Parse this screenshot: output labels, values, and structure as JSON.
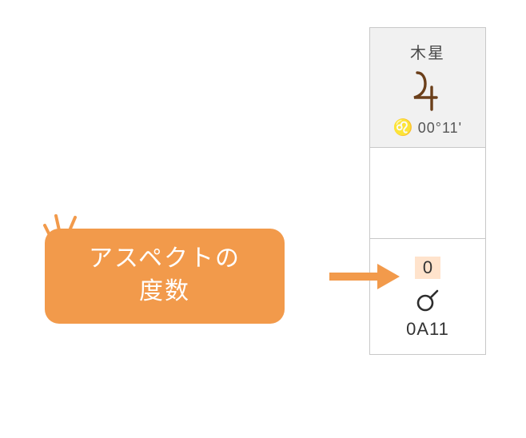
{
  "header": {
    "planet_name": "木星",
    "zodiac_symbol": "♌",
    "degrees": "00°11'"
  },
  "aspect": {
    "degree": "0",
    "code": "0A11"
  },
  "callout": {
    "line1": "アスペクトの",
    "line2": "度数"
  },
  "colors": {
    "jupiter": "#6b3f1a",
    "callout_bg": "#f29a4b"
  }
}
